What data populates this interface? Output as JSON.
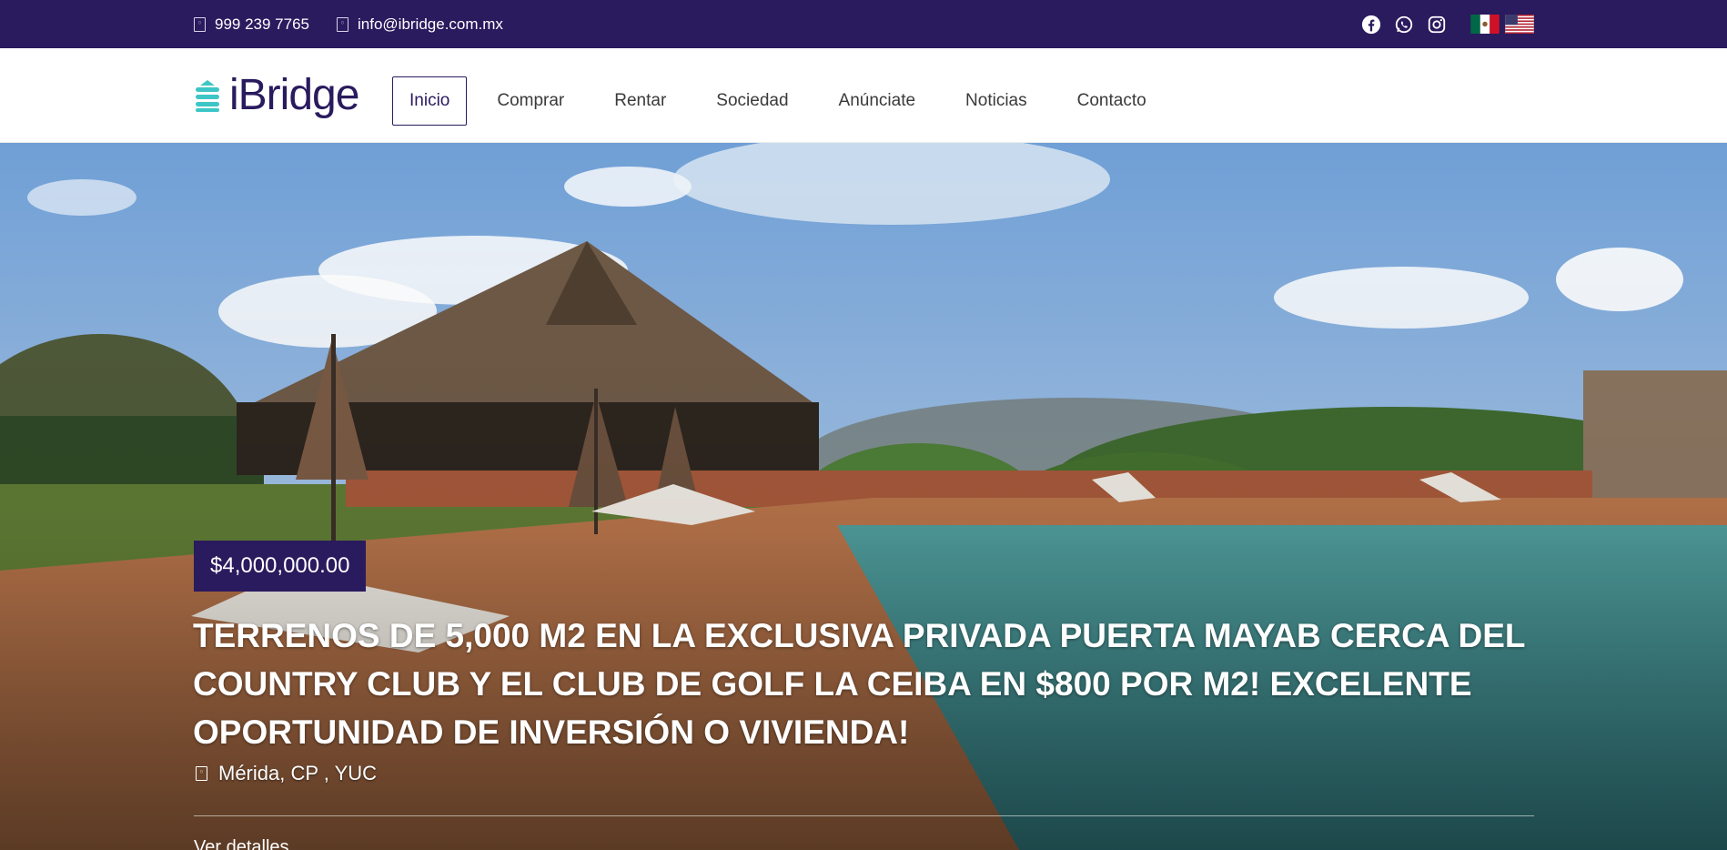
{
  "topbar": {
    "phone": "999 239 7765",
    "email": "info@ibridge.com.mx",
    "phone_icon": "phone-icon",
    "email_icon": "envelope-icon",
    "social": [
      "facebook-icon",
      "whatsapp-icon",
      "instagram-icon"
    ],
    "flags": [
      "mexico-flag",
      "usa-flag"
    ]
  },
  "brand": {
    "name": "iBridge"
  },
  "nav": {
    "items": [
      {
        "label": "Inicio",
        "active": true
      },
      {
        "label": "Comprar"
      },
      {
        "label": "Rentar"
      },
      {
        "label": "Sociedad"
      },
      {
        "label": "Anúnciate"
      },
      {
        "label": "Noticias"
      },
      {
        "label": "Contacto"
      }
    ]
  },
  "hero": {
    "price": "$4,000,000.00",
    "title": "TERRENOS DE 5,000 M2 EN LA EXCLUSIVA PRIVADA PUERTA MAYAB CERCA DEL COUNTRY CLUB Y EL CLUB DE GOLF LA CEIBA EN $800 POR M2! EXCELENTE OPORTUNIDAD DE INVERSIÓN O VIVIENDA!",
    "location": "Mérida, CP , YUC",
    "more_link": "Ver detalles"
  },
  "colors": {
    "brand": "#2a1a5e",
    "accent": "#3ec6c6"
  }
}
